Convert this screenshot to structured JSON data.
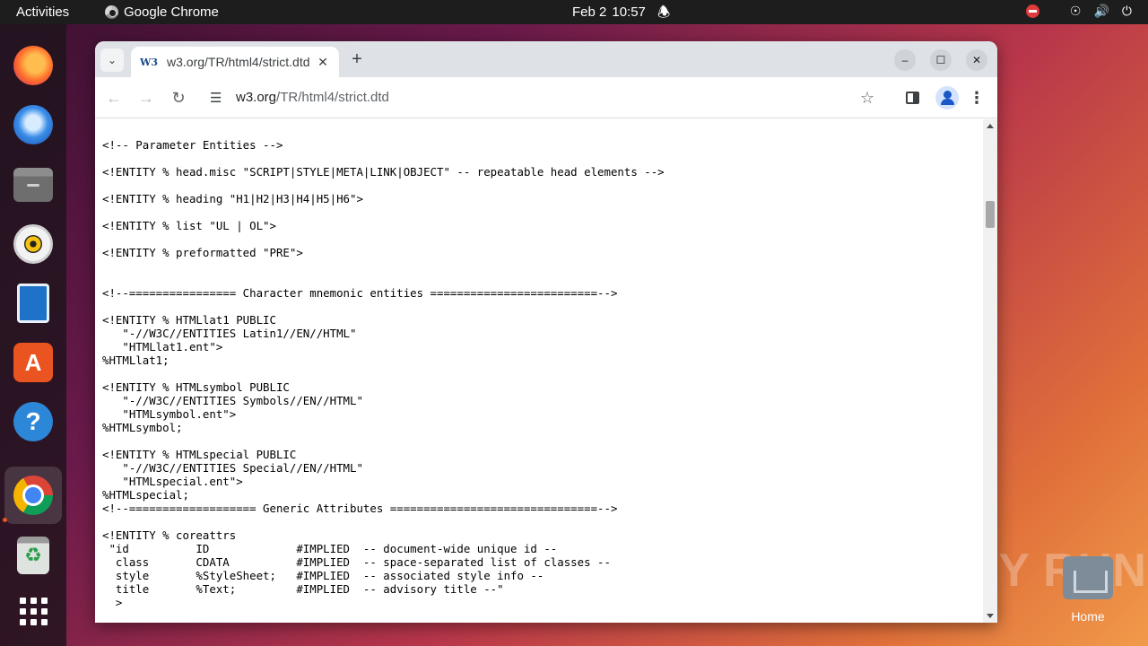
{
  "topbar": {
    "activities": "Activities",
    "app_name": "Google Chrome",
    "date": "Feb 2",
    "time": "10:57"
  },
  "dock": {
    "apps": [
      "Firefox",
      "Thunderbird",
      "Files",
      "Rhythmbox",
      "LibreOffice Writer",
      "Ubuntu Software",
      "Help",
      "Google Chrome",
      "Trash",
      "Show Applications"
    ],
    "active_app": "Google Chrome"
  },
  "desktop": {
    "home_label": "Home",
    "watermark": "ANY RUN"
  },
  "browser": {
    "tab": {
      "favicon_text": "W3",
      "title": "w3.org/TR/html4/strict.dtd"
    },
    "url_host": "w3.org",
    "url_path": "/TR/html4/strict.dtd",
    "document_text": "<!-- Parameter Entities -->\n\n<!ENTITY % head.misc \"SCRIPT|STYLE|META|LINK|OBJECT\" -- repeatable head elements -->\n\n<!ENTITY % heading \"H1|H2|H3|H4|H5|H6\">\n\n<!ENTITY % list \"UL | OL\">\n\n<!ENTITY % preformatted \"PRE\">\n\n\n<!--================ Character mnemonic entities =========================-->\n\n<!ENTITY % HTMLlat1 PUBLIC\n   \"-//W3C//ENTITIES Latin1//EN//HTML\"\n   \"HTMLlat1.ent\">\n%HTMLlat1;\n\n<!ENTITY % HTMLsymbol PUBLIC\n   \"-//W3C//ENTITIES Symbols//EN//HTML\"\n   \"HTMLsymbol.ent\">\n%HTMLsymbol;\n\n<!ENTITY % HTMLspecial PUBLIC\n   \"-//W3C//ENTITIES Special//EN//HTML\"\n   \"HTMLspecial.ent\">\n%HTMLspecial;\n<!--=================== Generic Attributes ===============================-->\n\n<!ENTITY % coreattrs\n \"id          ID             #IMPLIED  -- document-wide unique id --\n  class       CDATA          #IMPLIED  -- space-separated list of classes --\n  style       %StyleSheet;   #IMPLIED  -- associated style info --\n  title       %Text;         #IMPLIED  -- advisory title --\"\n  >"
  },
  "colors": {
    "topbar": "#1d1d1d",
    "tabstrip": "#dee1e6",
    "accent_ubuntu": "#e95420"
  }
}
